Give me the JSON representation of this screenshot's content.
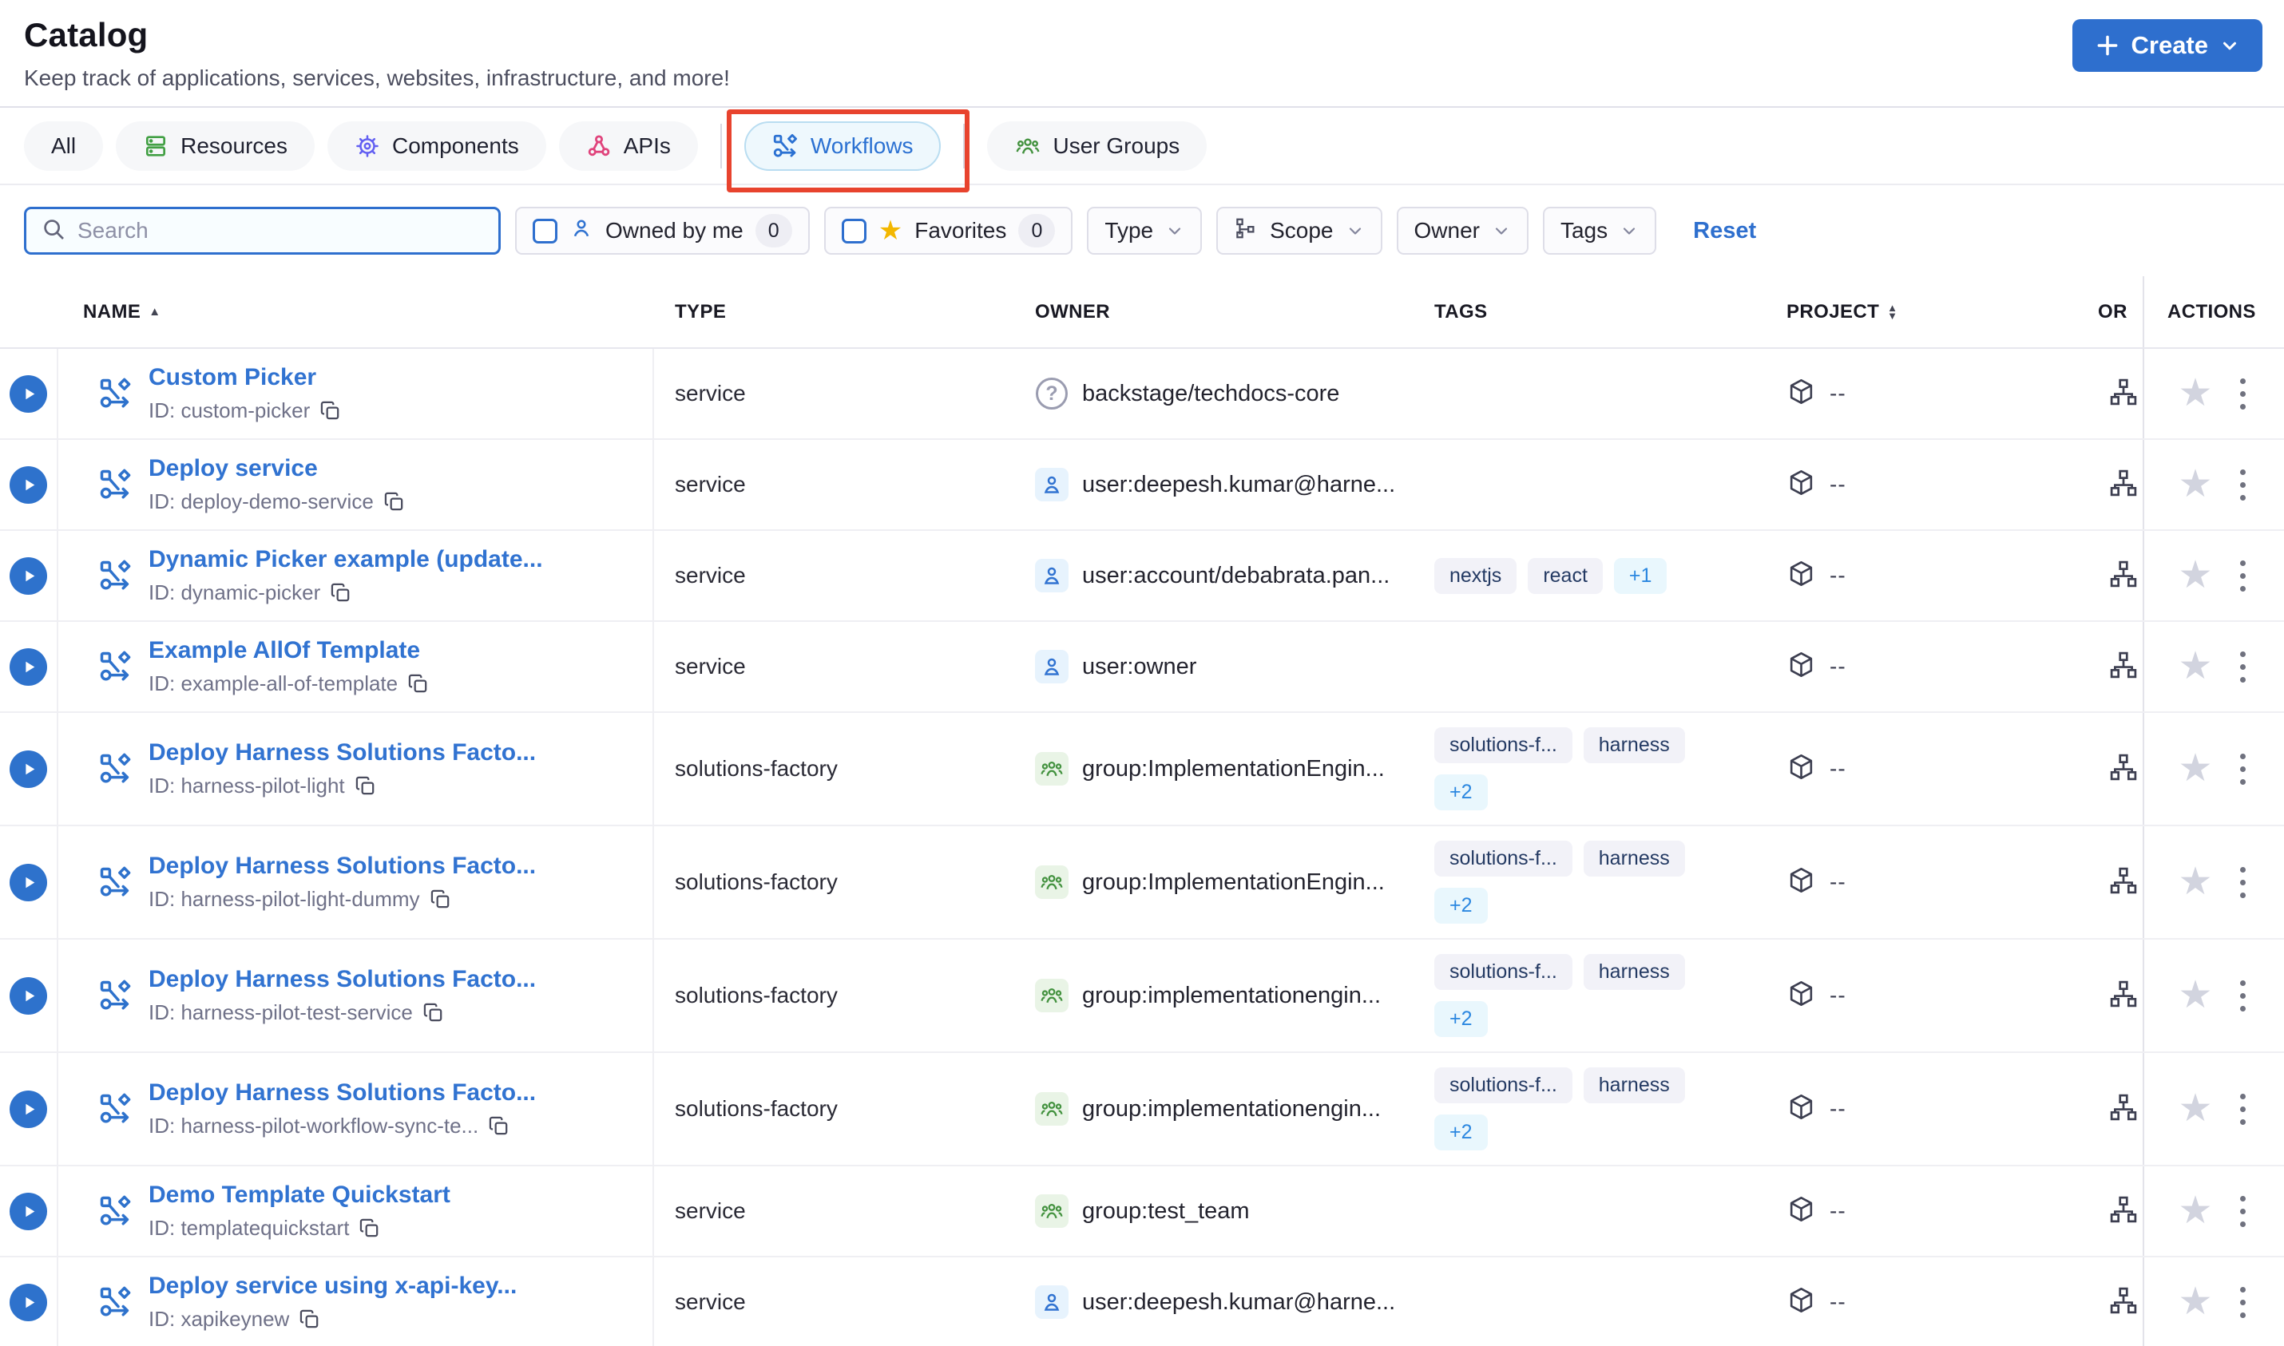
{
  "header": {
    "title": "Catalog",
    "subtitle": "Keep track of applications, services, websites, infrastructure, and more!",
    "create_label": "Create"
  },
  "colors": {
    "accent_blue": "#2e6fce",
    "link_blue": "#3173d1",
    "annotation_red": "#e8432e",
    "resources_green": "#42a044",
    "components_indigo": "#6360f2",
    "apis_pink": "#e0447c",
    "groups_green": "#43923f",
    "favorite_gold": "#f3b700"
  },
  "tabs": [
    {
      "label": "All"
    },
    {
      "label": "Resources"
    },
    {
      "label": "Components"
    },
    {
      "label": "APIs"
    },
    {
      "label": "Workflows",
      "active": true,
      "annotated": true
    },
    {
      "label": "User Groups"
    }
  ],
  "filters": {
    "search_placeholder": "Search",
    "owned_by_me": {
      "label": "Owned by me",
      "count": "0"
    },
    "favorites": {
      "label": "Favorites",
      "count": "0"
    },
    "type_label": "Type",
    "scope_label": "Scope",
    "owner_label": "Owner",
    "tags_label": "Tags",
    "reset_label": "Reset"
  },
  "table": {
    "columns": {
      "name": "NAME",
      "type": "TYPE",
      "owner": "OWNER",
      "tags": "TAGS",
      "project": "PROJECT",
      "org": "OR",
      "actions": "ACTIONS"
    },
    "project_placeholder": "--",
    "rows": [
      {
        "name": "Custom Picker",
        "id": "ID: custom-picker",
        "type": "service",
        "owner": {
          "kind": "unknown",
          "label": "backstage/techdocs-core"
        },
        "tags": [],
        "tags_wrap": false,
        "project": "--"
      },
      {
        "name": "Deploy service",
        "id": "ID: deploy-demo-service",
        "type": "service",
        "owner": {
          "kind": "user",
          "label": "user:deepesh.kumar@harne..."
        },
        "tags": [],
        "tags_wrap": false,
        "project": "--"
      },
      {
        "name": "Dynamic Picker example (update...",
        "id": "ID: dynamic-picker",
        "type": "service",
        "owner": {
          "kind": "user",
          "label": "user:account/debabrata.pan..."
        },
        "tags": [
          {
            "label": "nextjs",
            "more": false
          },
          {
            "label": "react",
            "more": false
          },
          {
            "label": "+1",
            "more": true
          }
        ],
        "tags_wrap": false,
        "project": "--"
      },
      {
        "name": "Example AllOf Template",
        "id": "ID: example-all-of-template",
        "type": "service",
        "owner": {
          "kind": "user",
          "label": "user:owner"
        },
        "tags": [],
        "tags_wrap": false,
        "project": "--"
      },
      {
        "name": "Deploy Harness Solutions Facto...",
        "id": "ID: harness-pilot-light",
        "type": "solutions-factory",
        "owner": {
          "kind": "group",
          "label": "group:ImplementationEngin..."
        },
        "tags": [
          {
            "label": "solutions-f...",
            "more": false
          },
          {
            "label": "harness",
            "more": false
          },
          {
            "label": "+2",
            "more": true
          }
        ],
        "tags_wrap": true,
        "project": "--"
      },
      {
        "name": "Deploy Harness Solutions Facto...",
        "id": "ID: harness-pilot-light-dummy",
        "type": "solutions-factory",
        "owner": {
          "kind": "group",
          "label": "group:ImplementationEngin..."
        },
        "tags": [
          {
            "label": "solutions-f...",
            "more": false
          },
          {
            "label": "harness",
            "more": false
          },
          {
            "label": "+2",
            "more": true
          }
        ],
        "tags_wrap": true,
        "project": "--"
      },
      {
        "name": "Deploy Harness Solutions Facto...",
        "id": "ID: harness-pilot-test-service",
        "type": "solutions-factory",
        "owner": {
          "kind": "group",
          "label": "group:implementationengin..."
        },
        "tags": [
          {
            "label": "solutions-f...",
            "more": false
          },
          {
            "label": "harness",
            "more": false
          },
          {
            "label": "+2",
            "more": true
          }
        ],
        "tags_wrap": true,
        "project": "--"
      },
      {
        "name": "Deploy Harness Solutions Facto...",
        "id": "ID: harness-pilot-workflow-sync-te...",
        "type": "solutions-factory",
        "owner": {
          "kind": "group",
          "label": "group:implementationengin..."
        },
        "tags": [
          {
            "label": "solutions-f...",
            "more": false
          },
          {
            "label": "harness",
            "more": false
          },
          {
            "label": "+2",
            "more": true
          }
        ],
        "tags_wrap": true,
        "project": "--"
      },
      {
        "name": "Demo Template Quickstart",
        "id": "ID: templatequickstart",
        "type": "service",
        "owner": {
          "kind": "group",
          "label": "group:test_team"
        },
        "tags": [],
        "tags_wrap": false,
        "project": "--"
      },
      {
        "name": "Deploy service using x-api-key...",
        "id": "ID: xapikeynew",
        "type": "service",
        "owner": {
          "kind": "user",
          "label": "user:deepesh.kumar@harne..."
        },
        "tags": [],
        "tags_wrap": false,
        "project": "--"
      }
    ]
  }
}
